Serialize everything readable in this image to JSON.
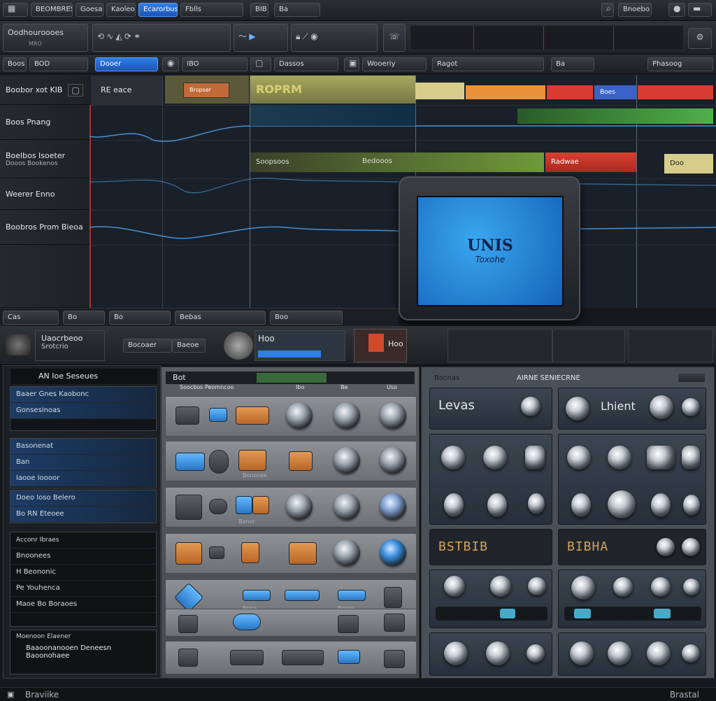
{
  "toolbar_top": {
    "items": [
      "BEOMBRES",
      "Goesac",
      "Kaoleor",
      "Ecarorbus",
      "Fblls",
      "BIB",
      "Ba",
      "Bnoebo"
    ]
  },
  "transport": {
    "title": "Oodhouroooes",
    "subtitle": "MRO"
  },
  "subbar": {
    "items": [
      "Boos",
      "BOD",
      "Dooer",
      "IBO",
      "Dassos",
      "Wooeriy",
      "Ragot",
      "Ba",
      "Phasoog"
    ]
  },
  "tracks": [
    {
      "label": "Boobor xot KIB"
    },
    {
      "label": "Boos Pnang"
    },
    {
      "label": "Boelbos Isoeter",
      "sublabel": "Dooos Bookenos"
    },
    {
      "label": "Weerer Enno"
    },
    {
      "label": "Boobros Prom Bieoa"
    }
  ],
  "track_header": {
    "value": "RE eace"
  },
  "clips": [
    {
      "label": "Bropser",
      "color": "#c26a3a"
    },
    {
      "label": "ROPRM",
      "color": "#b8b04a"
    },
    {
      "label": "Boes",
      "color": "#3a62c8"
    },
    {
      "label": "Soopsoos",
      "color": "#a8b86a"
    },
    {
      "label": "Bedooos",
      "color": "#a8b86a"
    },
    {
      "label": "Radwae",
      "color": "#c83a3a"
    },
    {
      "label": "Doo",
      "color": "#d6cd8a"
    }
  ],
  "monitor": {
    "title": "UNIS",
    "subtitle": "Toxohe"
  },
  "bottom_transport": {
    "items": [
      "Cas",
      "Bo",
      "Bo",
      "Bebas",
      "Boo"
    ]
  },
  "module_row": {
    "title": "Uaocrbeoo",
    "subtitle": "Srotcrio",
    "label1": "Bocoaer",
    "label2": "Baeoe",
    "label3": "Hoo",
    "label4": "Hoo"
  },
  "left_panel": {
    "header": "AN Ioe Seseues",
    "group1": [
      "Baaer Gnes Kaobonc",
      "Gonsesinoas"
    ],
    "group2": [
      "Basonenat",
      "Ban",
      "Iaooe Ioooor"
    ],
    "group3": [
      "Doeo Ioso Belero",
      "Bo RN Eteoee"
    ],
    "group4": [
      "Acconr Ibraes",
      "Bnoonees",
      "H Beononic",
      "Pe Youhenca",
      "Maoe Bo Boraoes"
    ],
    "footer_title": "Moenoon Elaener",
    "footer_lines": [
      "Baaoonanooen Deneesn",
      "Baoonohaee"
    ]
  },
  "rack_panel": {
    "header": "Bot",
    "subheader": "Soocbos Peomncoo",
    "col1": "Ibo",
    "col2": "Be",
    "col3": "Uso",
    "labels": [
      "Bonocee",
      "Bonor",
      "Bona",
      "Bonos"
    ]
  },
  "synth_panel": {
    "header": "Bocnas",
    "title": "AIRNE SENIECRNE",
    "left_title": "Levas",
    "right_title": "Lhient",
    "display_left": "BSTBIB",
    "display_right": "BIBHA"
  },
  "status_bar": {
    "left": "Braviike",
    "right": "Brastal"
  },
  "colors": {
    "accent_blue": "#2f7fe6",
    "clip_orange": "#e8903a",
    "clip_red": "#d83c32",
    "clip_green": "#4fb04a",
    "monitor_blue": "#1f8fe0"
  }
}
